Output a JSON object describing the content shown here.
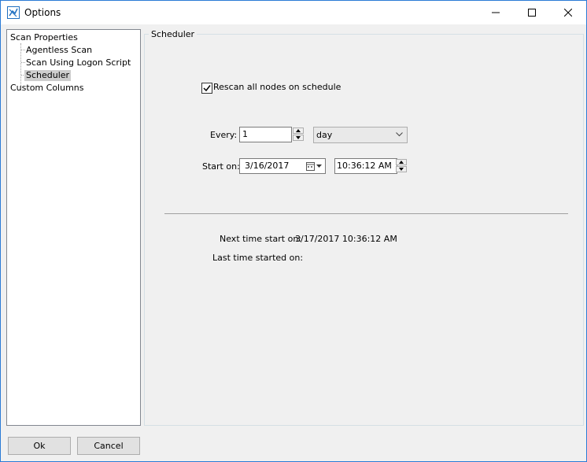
{
  "window": {
    "title": "Options",
    "icon": "app-icon",
    "controls": {
      "minimize": "minimize-icon",
      "maximize": "maximize-icon",
      "close": "close-icon"
    }
  },
  "tree": {
    "root": "Scan Properties",
    "children": [
      "Agentless Scan",
      "Scan Using Logon Script",
      "Scheduler"
    ],
    "selected": "Scheduler",
    "second_root": "Custom Columns"
  },
  "scheduler": {
    "group_label": "Scheduler",
    "rescan_label": "Rescan all nodes on schedule",
    "rescan_checked": true,
    "every_label": "Every:",
    "every_value": "1",
    "period_value": "day",
    "start_label": "Start on:",
    "start_date": "3/16/2017",
    "start_time": "10:36:12 AM",
    "next_label": "Next time start on:",
    "next_value": "3/17/2017 10:36:12 AM",
    "last_label": "Last time started on:",
    "last_value": ""
  },
  "buttons": {
    "ok": "Ok",
    "cancel": "Cancel"
  }
}
